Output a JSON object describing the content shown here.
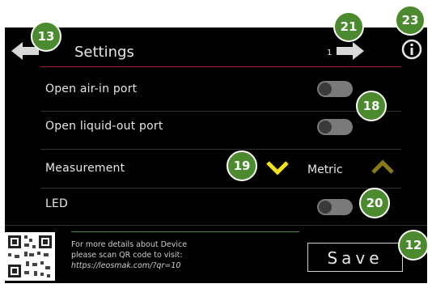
{
  "header": {
    "title": "Settings",
    "page_number": "1",
    "back_icon": "arrow-left-icon",
    "next_icon": "arrow-right-icon",
    "info_icon": "info-icon"
  },
  "settings": {
    "air_in": {
      "label": "Open air-in port",
      "toggle": "off"
    },
    "liquid_out": {
      "label": "Open liquid-out port",
      "toggle": "off"
    },
    "measurement": {
      "label": "Measurement",
      "value": "Metric",
      "down_icon": "chevron-down-icon",
      "up_icon": "chevron-up-icon"
    },
    "led": {
      "label": "LED",
      "toggle": "off"
    }
  },
  "footer": {
    "qr_icon": "qr-code-icon",
    "info_line1": "For more details about Device",
    "info_line2": "please scan QR code to visit:",
    "info_url": "https://leosmak.com/?qr=10",
    "save_label": "Save"
  },
  "callouts": {
    "c13": "13",
    "c21": "21",
    "c23": "23",
    "c18": "18",
    "c19": "19",
    "c20": "20",
    "c12": "12"
  },
  "colors": {
    "screen_bg": "#000000",
    "header_line": "#9a2430",
    "chevron_down": "#f2e01a",
    "chevron_up": "#8a7a14",
    "callout_bg": "#4c8a2f"
  }
}
